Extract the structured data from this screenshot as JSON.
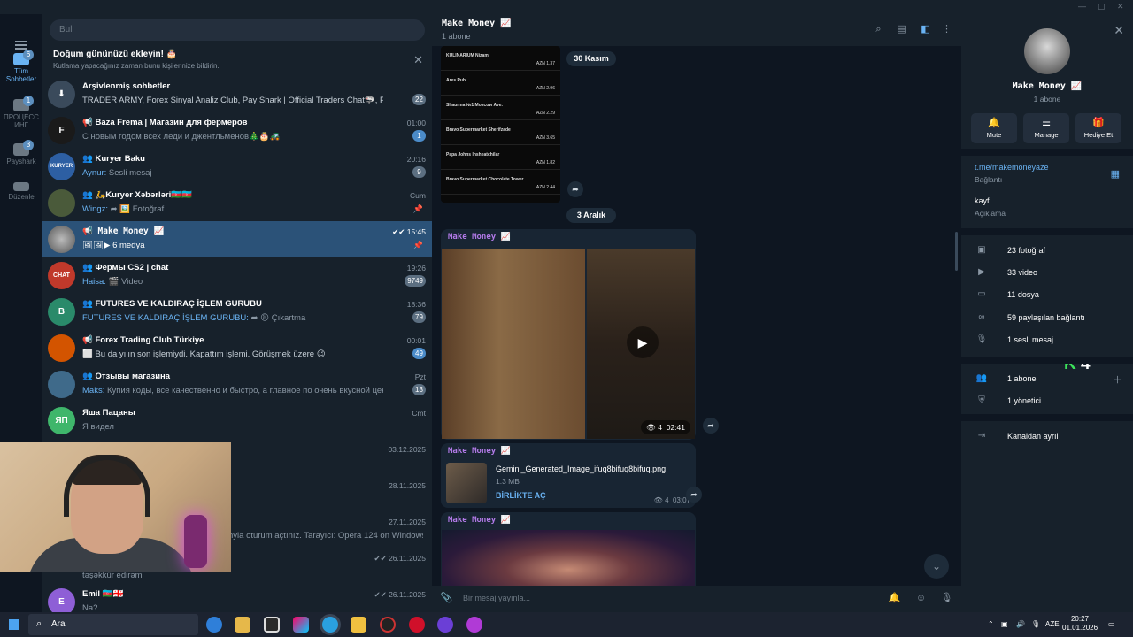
{
  "search": {
    "placeholder": "Bul"
  },
  "rail": {
    "items": [
      {
        "label": "Tüm\nSohbetler",
        "badge": "6",
        "active": true
      },
      {
        "label": "ПРОЦЕСС\nИНГ",
        "badge": "1",
        "active": false
      },
      {
        "label": "Payshark",
        "badge": "3",
        "active": false
      },
      {
        "label": "Düzenle",
        "badge": "",
        "active": false
      }
    ]
  },
  "birthday": {
    "title": "Doğum gününüzü ekleyin! 🎂",
    "subtitle": "Kutlama yapacağınız zaman bunu kişilerinize bildirin."
  },
  "chats": [
    {
      "name": "Arşivlenmiş sohbetler",
      "sender": "",
      "message": "TRADER ARMY, Forex Sinyal Analiz Club, Pay Shark | Official Traders Chat🦈, PayShark ...",
      "time": "",
      "badge": "22",
      "badge_style": "muted",
      "avatar": "⬇",
      "avatar_color": "#3a4a5b"
    },
    {
      "name": "📢 Baza Frema | Магазин для фермеров",
      "sender": "",
      "message": "С новым годом всех леди и джентльменов🎄🎂🚜",
      "time": "01:00",
      "badge": "1",
      "badge_style": "blue",
      "avatar": "F",
      "avatar_color": "#1a1a1a"
    },
    {
      "name": "👥 Kuryer Baku",
      "sender": "Aynur:",
      "message": " Sesli mesaj",
      "time": "20:16",
      "badge": "9",
      "badge_style": "muted",
      "avatar": "KURYER",
      "avatar_color": "#2d5fa3"
    },
    {
      "name": "👥 🛵Kuryer Xəbərləri🇦🇿🇦🇿",
      "sender": "Wingz:",
      "message": " ➦ 🖼️ Fotoğraf",
      "time": "Cum",
      "badge": "",
      "badge_style": "pin",
      "avatar": "",
      "avatar_color": "#4a5a3a"
    },
    {
      "name": "📢 Make Money 📈",
      "sender": "",
      "message": "🖼🖼▶ 6 medya",
      "time": "✔✔ 15:45",
      "badge": "",
      "badge_style": "pin",
      "avatar": "",
      "avatar_color": "#6e6e6e"
    },
    {
      "name": "👥 Фермы CS2 | chat",
      "sender": "Haisa:",
      "message": " 🎬 Video",
      "time": "19:26",
      "badge": "9749",
      "badge_style": "muted",
      "avatar": "CHAT",
      "avatar_color": "#c0392b"
    },
    {
      "name": "👥 FUTURES VE KALDIRAÇ İŞLEM GURUBU",
      "sender": "FUTURES VE KALDIRAÇ İŞLEM GURUBU:",
      "message": " ➦ 😩 Çıkartma",
      "time": "18:36",
      "badge": "79",
      "badge_style": "muted",
      "avatar": "B",
      "avatar_color": "#2a8a6a"
    },
    {
      "name": "📢 Forex Trading Club Türkiye",
      "sender": "",
      "message": "⬜ Bu da yılın son işlemiydi.  Kapattım işlemi. Görüşmek üzere 😉",
      "time": "00:01",
      "badge": "49",
      "badge_style": "blue",
      "avatar": "",
      "avatar_color": "#d35400"
    },
    {
      "name": "👥 Отзывы магазина",
      "sender": "Maks:",
      "message": " Купия коды, все качественно и быстро, а главное по очень вкусной цене!",
      "time": "Pzt",
      "badge": "13",
      "badge_style": "muted",
      "avatar": "",
      "avatar_color": "#3f6a8a"
    },
    {
      "name": "Яша Пацаны",
      "sender": "",
      "message": "Я видел",
      "time": "Cmt",
      "badge": "",
      "badge_style": "none",
      "avatar": "ЯП",
      "avatar_color": "#3fb66b"
    }
  ],
  "hidden_chats": [
    {
      "time": "03.12.2025"
    },
    {
      "time": "28.11.2025"
    },
    {
      "time": "27.11.2025",
      "message": "nyla oturum açtınız.  Tarayıcı: Opera 124 on Windows I..."
    },
    {
      "time": "✔✔ 26.11.2025",
      "message": "təşəkkür edirəm"
    },
    {
      "name": "Emil 🇦🇿🇬🇪",
      "message": "Na?",
      "time": "✔✔ 26.11.2025",
      "avatar": "E",
      "avatar_color": "#8e5fd6"
    }
  ],
  "main": {
    "title": "Make Money 📈",
    "subtitle": "1 abone",
    "dates": [
      "30 Kasım",
      "3 Aralık"
    ],
    "receipt_rows": [
      {
        "name": "KULINARIUM Nizami",
        "amount": "AZN 1.37"
      },
      {
        "name": "Ares Pub",
        "amount": "AZN 2.96"
      },
      {
        "name": "Shaurma №1 Moscow Ave.",
        "amount": "AZN 2.29"
      },
      {
        "name": "Bravo Supermarket Sherifzade",
        "amount": "AZN 3.65"
      },
      {
        "name": "Papa Johns Insheatchilar",
        "amount": "AZN 1.82"
      },
      {
        "name": "Bravo Supermarket Chocolate Tower",
        "amount": "AZN 2.44"
      }
    ],
    "video_post": {
      "author": "Make Money 📈",
      "views": "4",
      "time": "02:41"
    },
    "file_post": {
      "author": "Make Money 📈",
      "file_name": "Gemini_Generated_Image_ifuq8bifuq8bifuq.png",
      "file_size": "1.3 MB",
      "open_label": "BİRLİKTE AÇ",
      "views": "4",
      "time": "03:07"
    },
    "image_post": {
      "author": "Make Money 📈"
    },
    "compose_placeholder": "Bir mesaj yayınla..."
  },
  "info": {
    "name": "Make Money 📈",
    "subtitle": "1 abone",
    "actions": [
      {
        "label": "Mute",
        "icon": "bell-icon"
      },
      {
        "label": "Manage",
        "icon": "sliders-icon"
      },
      {
        "label": "Hediye Et",
        "icon": "gift-icon"
      }
    ],
    "link": "t.me/makemoneyaze",
    "link_label": "Bağlantı",
    "description": "kayf",
    "description_label": "Açıklama",
    "media": [
      "23 fotoğraf",
      "33 video",
      "11 dosya",
      "59 paylaşılan bağlantı",
      "1 sesli mesaj"
    ],
    "members": [
      "1 abone",
      "1 yönetici"
    ],
    "leave": "Kanaldan ayrıl"
  },
  "overlay": {
    "logo": "4"
  },
  "taskbar": {
    "search": "Ara",
    "lang": "AZE",
    "time": "20:27",
    "date": "01.01.2026"
  },
  "colors": {
    "accent": "#6ab3f3",
    "active_chat": "#2b5278",
    "bg": "#0e1621",
    "panel": "#17212b",
    "author": "#b27ae8"
  }
}
